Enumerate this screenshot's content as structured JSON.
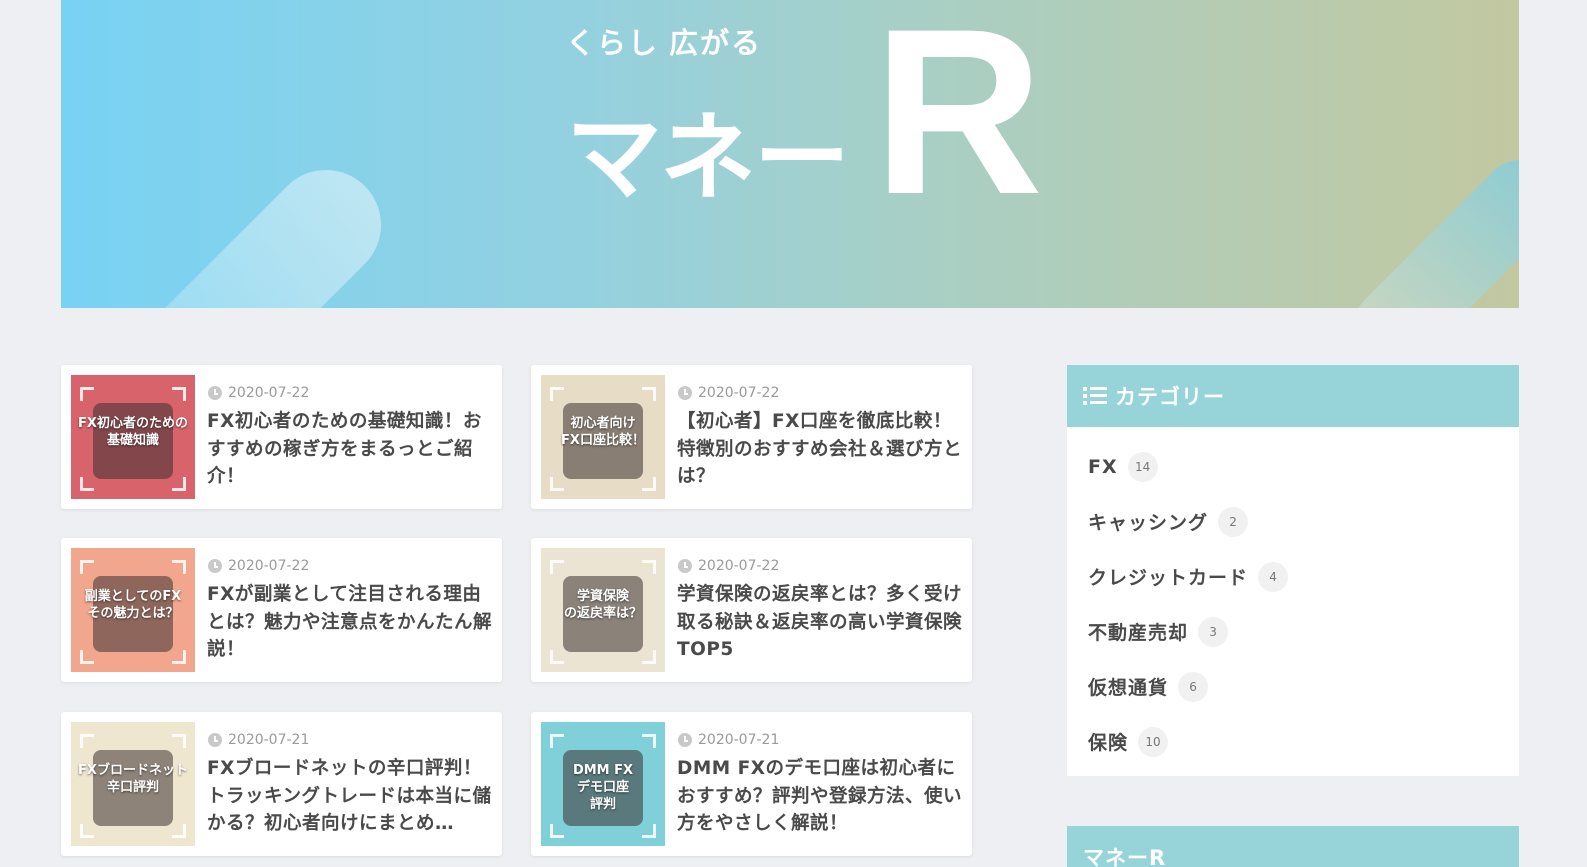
{
  "header": {
    "tagline": "くらし 広がる",
    "logo_main": "マネー",
    "logo_r": "R"
  },
  "posts": [
    {
      "date": "2020-07-22",
      "title": "FX初心者のための基礎知識！おすすめの稼ぎ方をまるっとご紹介！",
      "thumb_text": "FX初心者のための\n基礎知識",
      "thumb_bg": "#d9636b"
    },
    {
      "date": "2020-07-22",
      "title": "【初心者】FX口座を徹底比較！特徴別のおすすめ会社＆選び方とは？",
      "thumb_text": "初心者向け\nFX口座比較！",
      "thumb_bg": "#e7dcc6"
    },
    {
      "date": "2020-07-22",
      "title": "FXが副業として注目される理由とは？魅力や注意点をかんたん解説！",
      "thumb_text": "副業としてのFX\nその魅力とは？",
      "thumb_bg": "#f2a68e"
    },
    {
      "date": "2020-07-22",
      "title": "学資保険の返戻率とは？多く受け取る秘訣＆返戻率の高い学資保険TOP5",
      "thumb_text": "学資保険\nの返戻率は？",
      "thumb_bg": "#ece4d2"
    },
    {
      "date": "2020-07-21",
      "title": "FXブロードネットの辛口評判！トラッキングトレードは本当に儲かる？初心者向けにまとめ…",
      "thumb_text": "FXブロードネット\n辛口評判",
      "thumb_bg": "#efe6cf"
    },
    {
      "date": "2020-07-21",
      "title": "DMM FXのデモ口座は初心者におすすめ？評判や登録方法、使い方をやさしく解説！",
      "thumb_text": "DMM FX\nデモ口座\n評判",
      "thumb_bg": "#7fd0d8"
    }
  ],
  "sidebar": {
    "heading": "カテゴリー",
    "categories": [
      {
        "label": "FX",
        "count": "14"
      },
      {
        "label": "キャッシング",
        "count": "2"
      },
      {
        "label": "クレジットカード",
        "count": "4"
      },
      {
        "label": "不動産売却",
        "count": "3"
      },
      {
        "label": "仮想通貨",
        "count": "6"
      },
      {
        "label": "保険",
        "count": "10"
      }
    ],
    "widget2_heading": "マネーR"
  },
  "colors": {
    "accent": "#96d4d9",
    "background": "#eeeff3"
  },
  "icons": {
    "date": "clock-icon",
    "category_heading": "list-icon"
  }
}
